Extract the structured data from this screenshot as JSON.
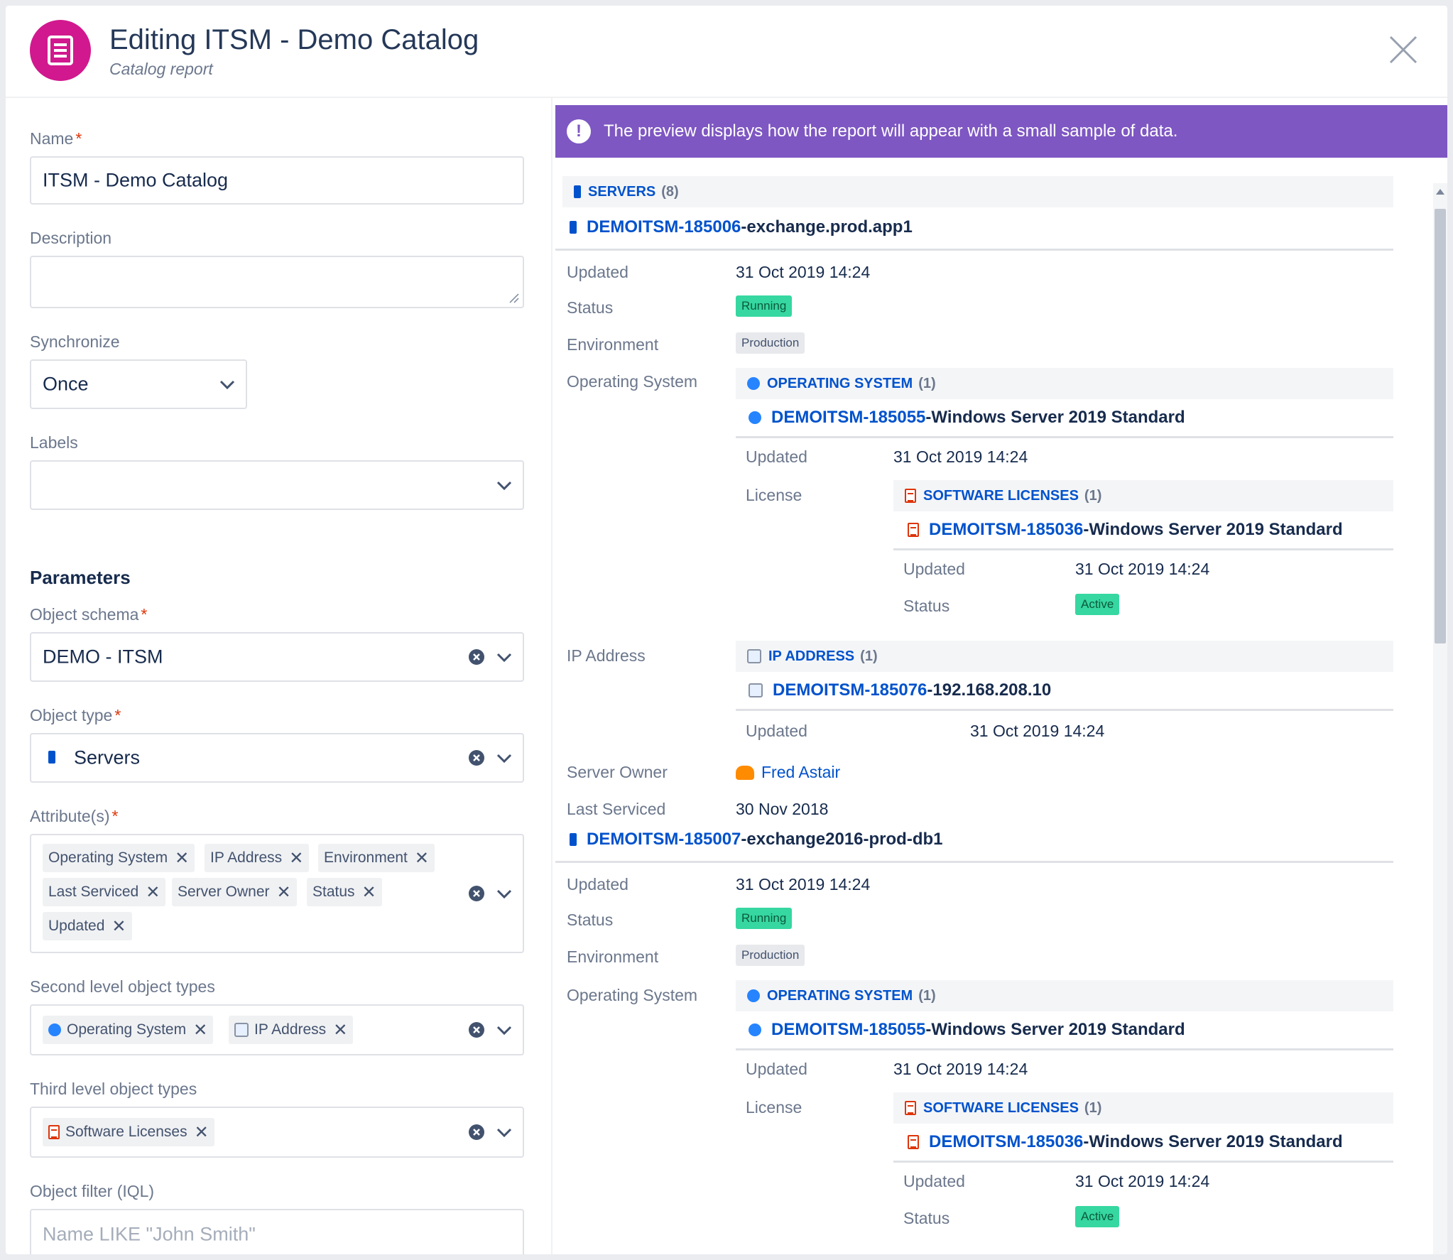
{
  "header": {
    "title": "Editing ITSM - Demo Catalog",
    "subtitle": "Catalog report"
  },
  "form": {
    "name_label": "Name",
    "name_value": "ITSM - Demo Catalog",
    "description_label": "Description",
    "synchronize_label": "Synchronize",
    "synchronize_value": "Once",
    "labels_label": "Labels",
    "parameters_heading": "Parameters",
    "object_schema_label": "Object schema",
    "object_schema_value": "DEMO - ITSM",
    "object_type_label": "Object type",
    "object_type_value": "Servers",
    "attributes_label": "Attribute(s)",
    "attributes": [
      "Operating System",
      "IP Address",
      "Environment",
      "Last Serviced",
      "Server Owner",
      "Status",
      "Updated"
    ],
    "second_level_label": "Second level object types",
    "second_level": [
      "Operating System",
      "IP Address"
    ],
    "third_level_label": "Third level object types",
    "third_level": [
      "Software Licenses"
    ],
    "iql_label": "Object filter (IQL)",
    "iql_placeholder": "Name LIKE \"John Smith\"",
    "required_mark": "*"
  },
  "preview": {
    "banner": "The preview displays how the report will appear with a small sample of data.",
    "servers_header": "SERVERS",
    "servers_count": "(8)",
    "labels": {
      "updated": "Updated",
      "status": "Status",
      "environment": "Environment",
      "operating_system": "Operating System",
      "license": "License",
      "ip_address": "IP Address",
      "server_owner": "Server Owner",
      "last_serviced": "Last Serviced"
    },
    "os_header": "OPERATING SYSTEM",
    "os_count": "(1)",
    "lic_header": "SOFTWARE LICENSES",
    "lic_count": "(1)",
    "ip_header": "IP ADDRESS",
    "ip_count": "(1)",
    "sep": " - ",
    "server1": {
      "key": "DEMOITSM-185006",
      "name": "exchange.prod.app1",
      "updated": "31 Oct 2019 14:24",
      "status": "Running",
      "environment": "Production",
      "os_key": "DEMOITSM-185055",
      "os_name": "Windows Server 2019 Standard",
      "os_updated": "31 Oct 2019 14:24",
      "lic_key": "DEMOITSM-185036",
      "lic_name": "Windows Server 2019 Standard",
      "lic_updated": "31 Oct 2019 14:24",
      "lic_status": "Active",
      "ip_key": "DEMOITSM-185076",
      "ip_name": "192.168.208.10",
      "ip_updated": "31 Oct 2019 14:24",
      "owner": "Fred Astair",
      "last_serviced": "30 Nov 2018"
    },
    "server2": {
      "key": "DEMOITSM-185007",
      "name": "exchange2016-prod-db1",
      "updated": "31 Oct 2019 14:24",
      "status": "Running",
      "environment": "Production",
      "os_key": "DEMOITSM-185055",
      "os_name": "Windows Server 2019 Standard",
      "os_updated": "31 Oct 2019 14:24",
      "lic_key": "DEMOITSM-185036",
      "lic_name": "Windows Server 2019 Standard",
      "lic_updated": "31 Oct 2019 14:24",
      "lic_status": "Active"
    }
  },
  "colors": {
    "brand": "#d1188e",
    "banner": "#7e57c2",
    "link": "#0052cc",
    "status_green": "#36d7a1"
  },
  "icons": [
    "report-icon",
    "close-icon",
    "chevron-down-icon",
    "clear-icon",
    "server-icon",
    "os-icon",
    "license-icon",
    "ip-icon",
    "user-icon",
    "info-icon"
  ]
}
